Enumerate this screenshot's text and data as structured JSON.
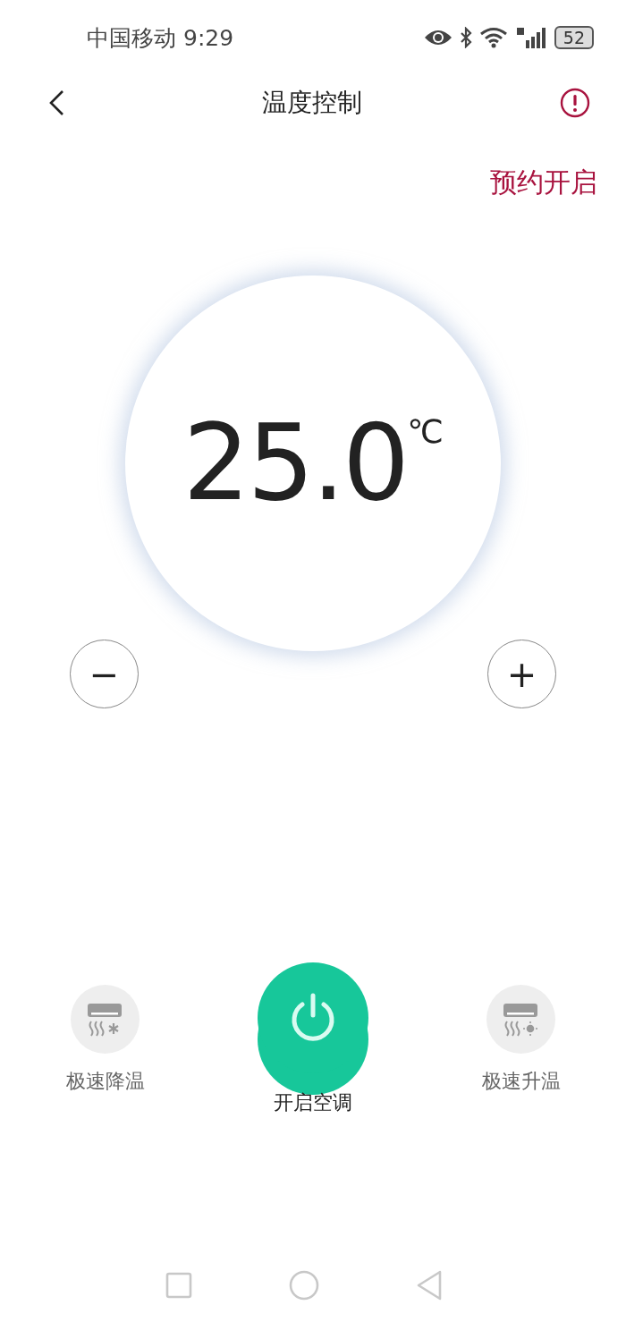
{
  "status_bar": {
    "carrier": "中国移动",
    "time": "9:29",
    "battery": "52"
  },
  "header": {
    "title": "温度控制"
  },
  "schedule": {
    "label": "预约开启"
  },
  "dial": {
    "temperature": "25.0",
    "unit": "℃"
  },
  "stepper": {
    "decrease": "−",
    "increase": "+"
  },
  "modes": [
    {
      "kind": "cool",
      "label": "极速降温"
    },
    {
      "kind": "power",
      "label": "开启空调"
    },
    {
      "kind": "heat",
      "label": "极速升温"
    }
  ]
}
